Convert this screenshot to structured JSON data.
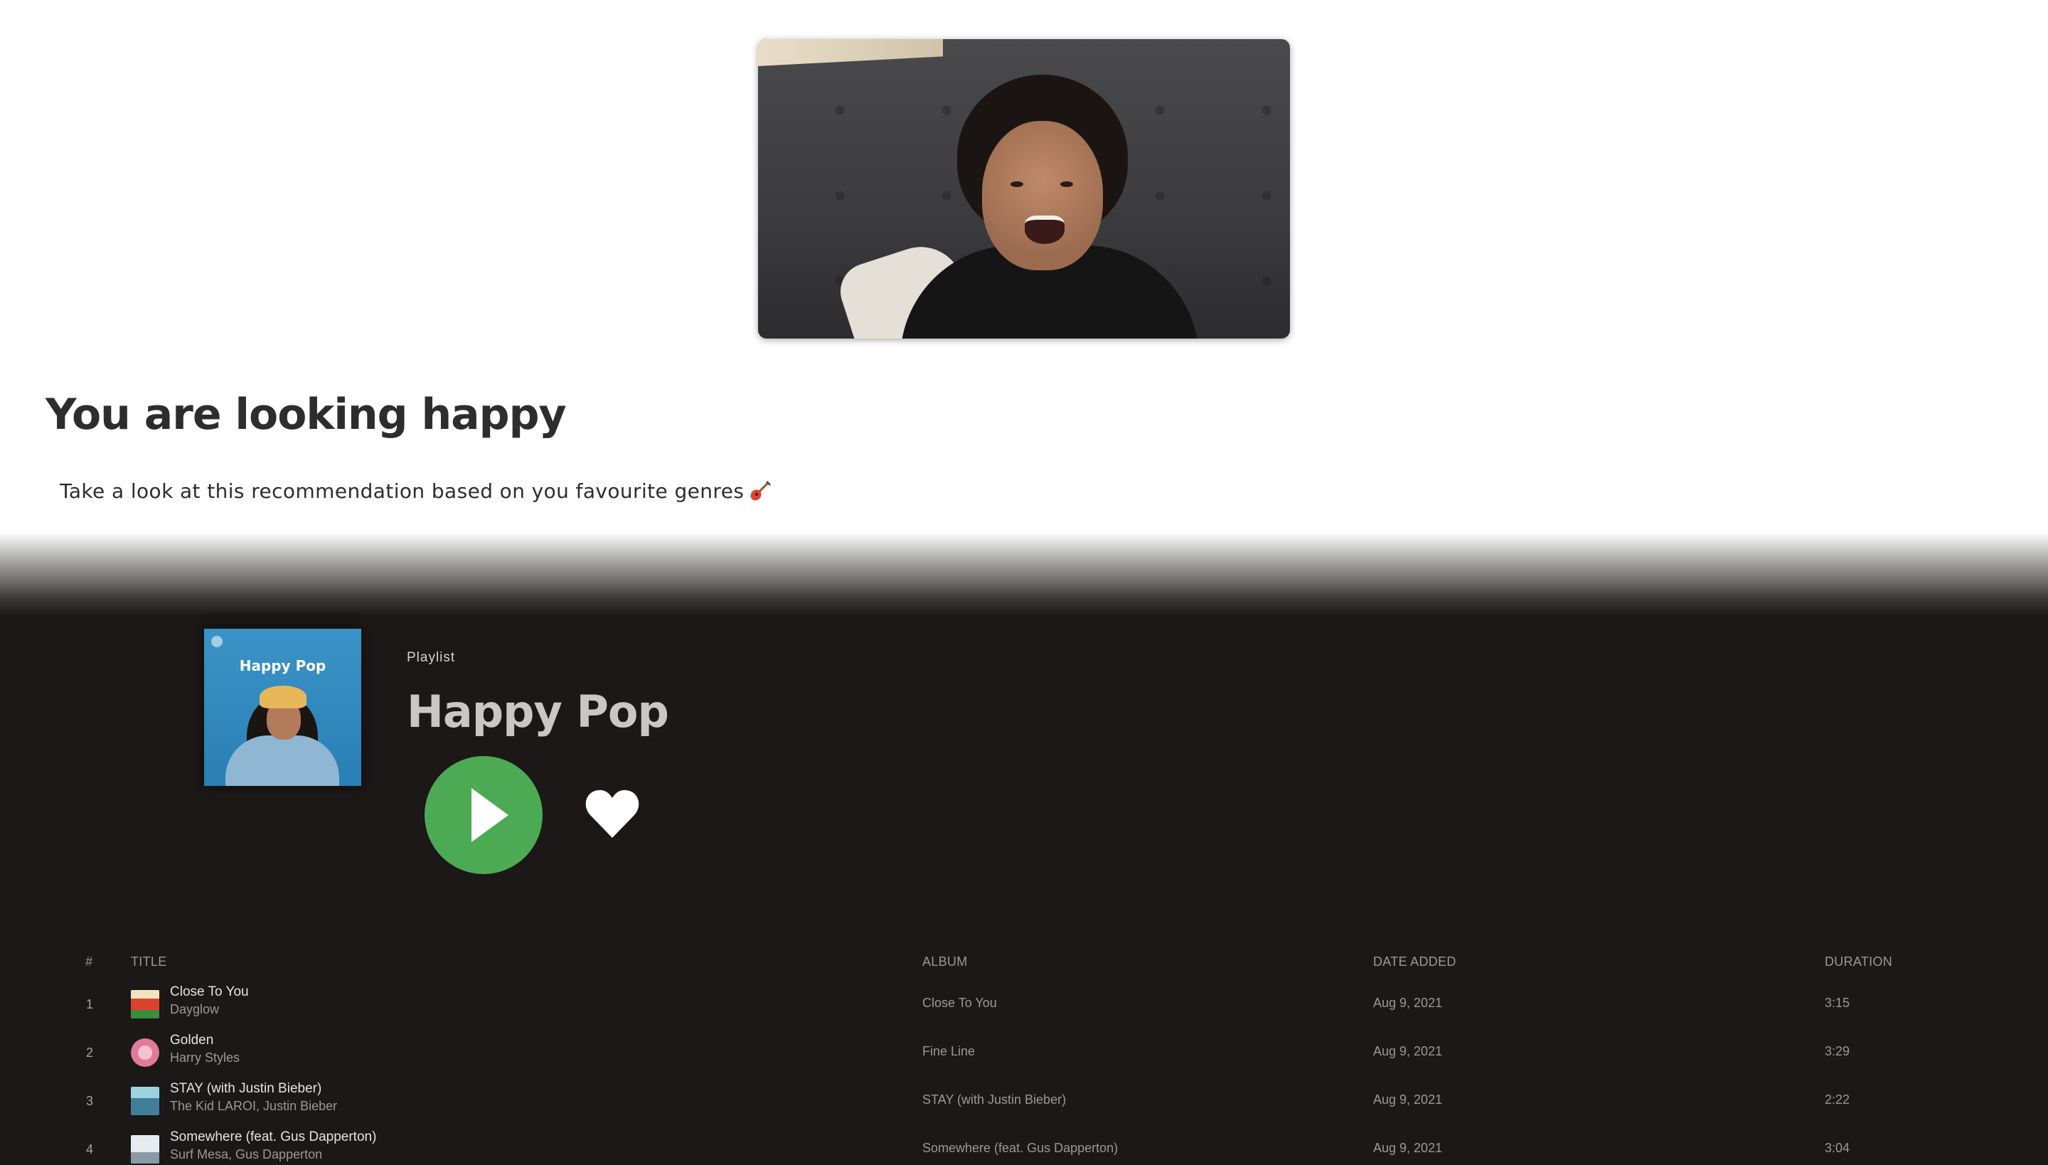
{
  "mood": {
    "headline": "You are looking happy",
    "subtext": "Take a look at this recommendation based on you favourite genres",
    "emoji_icon": "guitar-icon"
  },
  "playlist": {
    "type_label": "Playlist",
    "title": "Happy Pop",
    "cover_title": "Happy Pop",
    "accent_color": "#4caa55",
    "play_icon": "play-icon",
    "like_icon": "heart-icon"
  },
  "table": {
    "headers": {
      "num": "#",
      "title": "TITLE",
      "album": "ALBUM",
      "date_added": "DATE ADDED",
      "duration": "DURATION"
    },
    "tracks": [
      {
        "num": "1",
        "title": "Close To You",
        "artist": "Dayglow",
        "album": "Close To You",
        "date_added": "Aug 9, 2021",
        "duration": "3:15",
        "thumb_color": "#d9442e"
      },
      {
        "num": "2",
        "title": "Golden",
        "artist": "Harry Styles",
        "album": "Fine Line",
        "date_added": "Aug 9, 2021",
        "duration": "3:29",
        "thumb_color": "#e27a9a"
      },
      {
        "num": "3",
        "title": "STAY (with Justin Bieber)",
        "artist": "The Kid LAROI, Justin Bieber",
        "album": "STAY (with Justin Bieber)",
        "date_added": "Aug 9, 2021",
        "duration": "2:22",
        "thumb_color": "#3f7f9a"
      },
      {
        "num": "4",
        "title": "Somewhere (feat. Gus Dapperton)",
        "artist": "Surf Mesa, Gus Dapperton",
        "album": "Somewhere (feat. Gus Dapperton)",
        "date_added": "Aug 9, 2021",
        "duration": "3:04",
        "thumb_color": "#c9d3da"
      }
    ]
  }
}
